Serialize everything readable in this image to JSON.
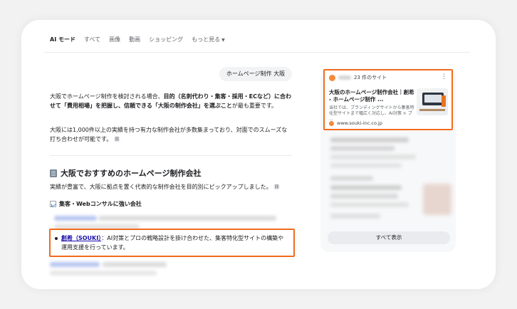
{
  "tabs": {
    "ai_mode": "AI モード",
    "all": "すべて",
    "images": "画像",
    "videos": "動画",
    "shopping": "ショッピング",
    "more": "もっと見る"
  },
  "query": "ホームページ制作 大阪",
  "answer": {
    "p1_a": "大阪でホームページ制作を検討される場合、",
    "p1_b": "目的（名刺代わり・集客・採用・ECなど）に合わせて「費用相場」を把握し、信頼できる「大阪の制作会社」を選ぶこと",
    "p1_c": "が最も重要です。",
    "p2": "大阪には1,000件以上の実績を持つ有力な制作会社が多数集まっており、対面でのスムーズな打ち合わせが可能です。",
    "heading": "大阪でおすすめのホームページ制作会社",
    "intro": "実績が豊富で、大阪に拠点を置く代表的な制作会社を目的別にピックアップしました。",
    "subheading": "集客・Webコンサルに強い会社",
    "bullet_link": "創希（SOUKI）",
    "bullet_text_1": "：AI対策とプロの戦略設計を掛け合わせた、集客特化型サイトの構築や",
    "bullet_text_2": "運用支援を行っています。"
  },
  "sources": {
    "count_label": "23 件のサイト",
    "card_title": "大阪のホームページ制作会社｜創希 - ホームページ制作 ...",
    "card_snippet": "当社では、ブランディングサイトから集客特化型サイトまで幅広く対応し、AI対策 × プ ...",
    "card_site": "www.souki-inc.co.jp",
    "show_all": "すべて表示"
  },
  "colors": {
    "highlight": "#f26b1d",
    "link": "#1a0dab"
  },
  "icons": [
    "chevron-down-icon",
    "link-icon",
    "building-icon",
    "chart-icon",
    "kebab-menu-icon",
    "favicon-icon"
  ]
}
